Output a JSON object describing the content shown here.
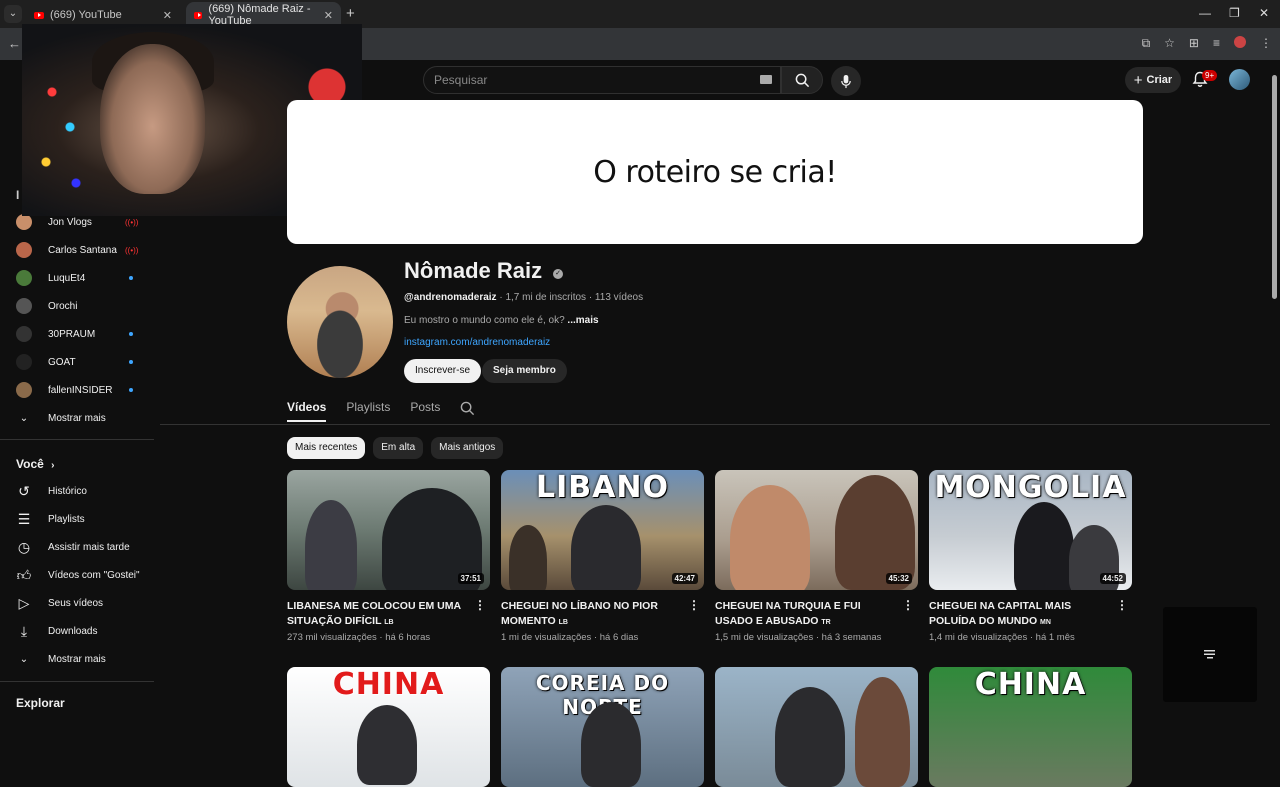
{
  "browser": {
    "tabs": [
      {
        "title": "(669) YouTube"
      },
      {
        "title": "(669) Nômade Raiz - YouTube"
      }
    ]
  },
  "header": {
    "search_placeholder": "Pesquisar",
    "create_label": "Criar",
    "notif_badge": "9+"
  },
  "sidebar": {
    "subscriptions": [
      {
        "name": "Jon Vlogs",
        "status": "live",
        "color": "#c98f6a"
      },
      {
        "name": "Carlos Santana",
        "status": "live",
        "color": "#b9664a"
      },
      {
        "name": "LuquEt4",
        "status": "new",
        "color": "#4a7a3a"
      },
      {
        "name": "Orochi",
        "status": "none",
        "color": "#555555"
      },
      {
        "name": "30PRAUM",
        "status": "new",
        "color": "#333333"
      },
      {
        "name": "GOAT",
        "status": "new",
        "color": "#222222"
      },
      {
        "name": "fallenINSIDER",
        "status": "new",
        "color": "#8a6a4a"
      }
    ],
    "subs_more": "Mostrar mais",
    "section_voce": "Você",
    "voce_items": [
      {
        "label": "Histórico",
        "icon": "history-icon"
      },
      {
        "label": "Playlists",
        "icon": "playlist-icon"
      },
      {
        "label": "Assistir mais tarde",
        "icon": "clock-icon"
      },
      {
        "label": "Vídeos com \"Gostei\"",
        "icon": "thumbs-up-icon"
      },
      {
        "label": "Seus vídeos",
        "icon": "your-videos-icon"
      },
      {
        "label": "Downloads",
        "icon": "download-icon"
      }
    ],
    "voce_more": "Mostrar mais",
    "section_explorar": "Explorar"
  },
  "channel": {
    "banner_text": "O roteiro se cria!",
    "name": "Nômade Raiz",
    "handle": "@andrenomaderaiz",
    "subscribers": "· 1,7 mi de inscritos",
    "video_count": "· 113 vídeos",
    "description": "Eu mostro o mundo como ele é, ok?",
    "description_more": "...mais",
    "link": "instagram.com/andrenomaderaiz",
    "subscribe_label": "Inscrever-se",
    "member_label": "Seja membro"
  },
  "tabs": [
    "Vídeos",
    "Playlists",
    "Posts"
  ],
  "chips": [
    "Mais recentes",
    "Em alta",
    "Mais antigos"
  ],
  "videos": [
    {
      "title": "LIBANESA ME COLOCOU EM UMA SITUAÇÃO DIFÍCIL",
      "tag": "LB",
      "views": "273 mil visualizações",
      "age": "há 6 horas",
      "duration": "37:51",
      "thumb_text": ""
    },
    {
      "title": "CHEGUEI NO LÍBANO NO PIOR MOMENTO",
      "tag": "LB",
      "views": "1 mi de visualizações",
      "age": "há 6 dias",
      "duration": "42:47",
      "thumb_text": "LIBANO"
    },
    {
      "title": "CHEGUEI NA TURQUIA E FUI USADO E ABUSADO",
      "tag": "TR",
      "views": "1,5 mi de visualizações",
      "age": "há 3 semanas",
      "duration": "45:32",
      "thumb_text": ""
    },
    {
      "title": "CHEGUEI NA CAPITAL MAIS POLUÍDA DO MUNDO",
      "tag": "MN",
      "views": "1,4 mi de visualizações",
      "age": "há 1 mês",
      "duration": "44:52",
      "thumb_text": "MONGOLIA"
    }
  ],
  "videos_row2": [
    {
      "thumb_text": "CHINA"
    },
    {
      "thumb_text": "COREIA DO NORTE"
    },
    {
      "thumb_text": ""
    },
    {
      "thumb_text": "CHINA"
    }
  ]
}
